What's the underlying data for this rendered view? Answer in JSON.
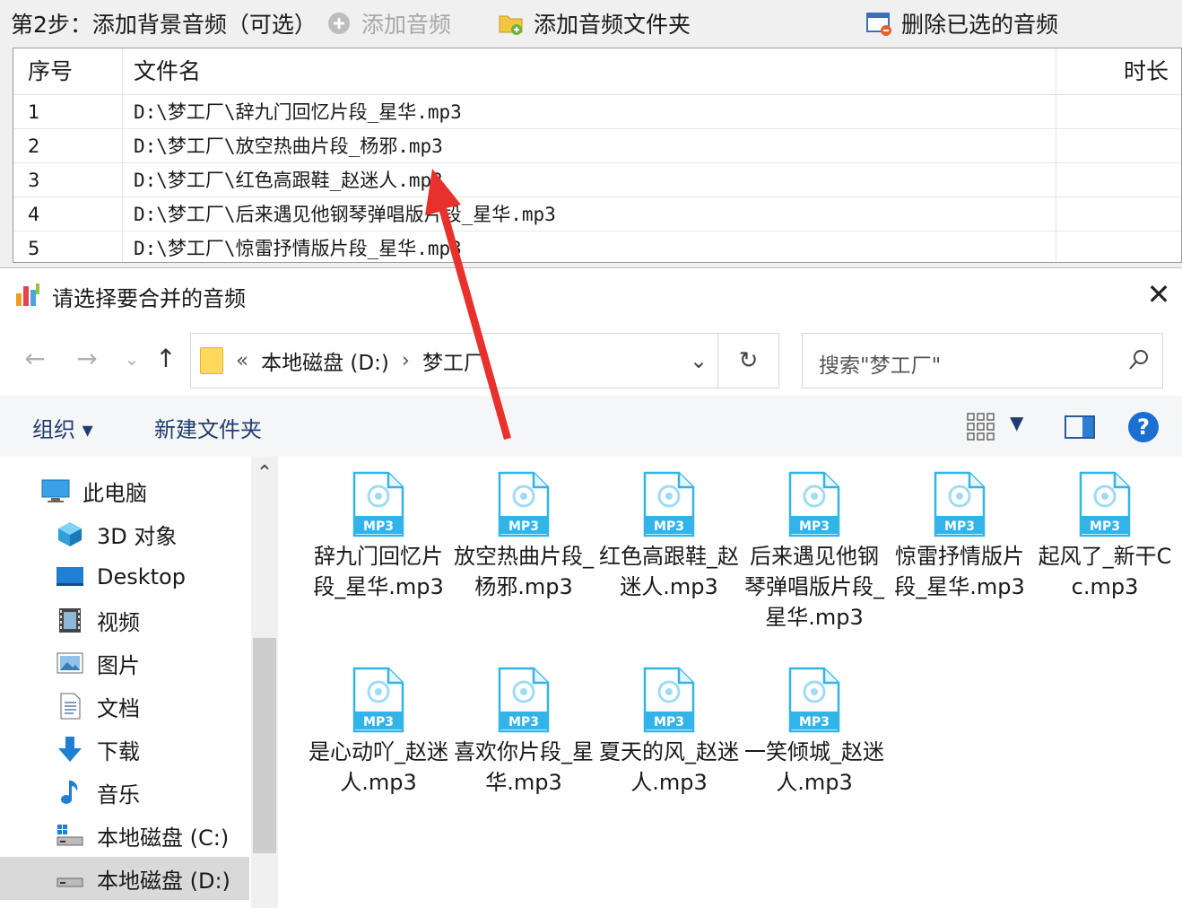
{
  "toolbar": {
    "step_label": "第2步：添加背景音频（可选）",
    "add_audio_label": "添加音频",
    "add_folder_label": "添加音频文件夹",
    "delete_label": "删除已选的音频"
  },
  "table": {
    "headers": {
      "no": "序号",
      "name": "文件名",
      "duration": "时长"
    },
    "rows": [
      {
        "no": "1",
        "name": "D:\\梦工厂\\辞九门回忆片段_星华.mp3"
      },
      {
        "no": "2",
        "name": "D:\\梦工厂\\放空热曲片段_杨邪.mp3"
      },
      {
        "no": "3",
        "name": "D:\\梦工厂\\红色高跟鞋_赵迷人.mp3"
      },
      {
        "no": "4",
        "name": "D:\\梦工厂\\后来遇见他钢琴弹唱版片段_星华.mp3"
      },
      {
        "no": "5",
        "name": "D:\\梦工厂\\惊雷抒情版片段_星华.mp3"
      }
    ]
  },
  "dialog": {
    "title": "请选择要合并的音频",
    "nav": {
      "back_icon": "←",
      "forward_icon": "→",
      "recent_icon": "⌄",
      "up_icon": "↑",
      "path_prefix": "«",
      "path_drive": "本地磁盘 (D:)",
      "path_sep": "›",
      "path_folder": "梦工厂",
      "dropdown_icon": "⌄",
      "refresh_icon": "↻",
      "search_placeholder": "搜索\"梦工厂\""
    },
    "commands": {
      "organize": "组织 ▾",
      "new_folder": "新建文件夹",
      "view_dropdown": "▼",
      "help": "?"
    },
    "sidebar": [
      {
        "label": "此电脑",
        "icon": "computer-icon"
      },
      {
        "label": "3D 对象",
        "icon": "cube-icon"
      },
      {
        "label": "Desktop",
        "icon": "desktop-icon"
      },
      {
        "label": "视频",
        "icon": "video-icon"
      },
      {
        "label": "图片",
        "icon": "picture-icon"
      },
      {
        "label": "文档",
        "icon": "document-icon"
      },
      {
        "label": "下载",
        "icon": "download-icon"
      },
      {
        "label": "音乐",
        "icon": "music-icon"
      },
      {
        "label": "本地磁盘 (C:)",
        "icon": "drive-c-icon"
      },
      {
        "label": "本地磁盘 (D:)",
        "icon": "drive-d-icon",
        "selected": true
      }
    ],
    "files": [
      "辞九门回忆片段_星华.mp3",
      "放空热曲片段_杨邪.mp3",
      "红色高跟鞋_赵迷人.mp3",
      "后来遇见他钢琴弹唱版片段_星华.mp3",
      "惊雷抒情版片段_星华.mp3",
      "起风了_新干Cc.mp3",
      "是心动吖_赵迷人.mp3",
      "喜欢你片段_星华.mp3",
      "夏天的风_赵迷人.mp3",
      "一笑倾城_赵迷人.mp3"
    ],
    "file_icon_label": "MP3"
  },
  "colors": {
    "accent": "#1a6fd0",
    "mp3_icon": "#33b4e8",
    "arrow": "#e8302c"
  }
}
